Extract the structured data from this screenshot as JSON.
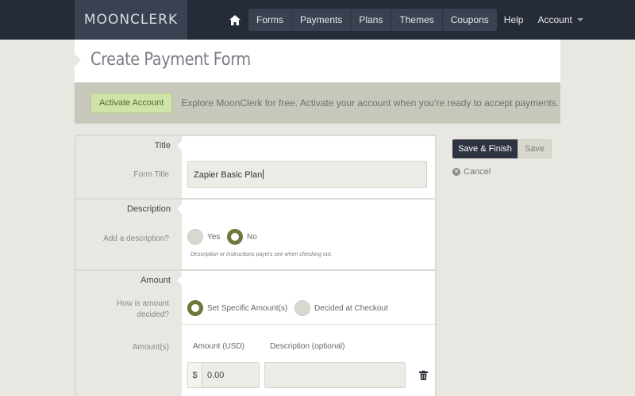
{
  "brand": {
    "logo_text_a": "MOON",
    "logo_text_b": "CLERK"
  },
  "nav": {
    "home_icon": "home-icon",
    "items": [
      {
        "label": "Forms"
      },
      {
        "label": "Payments"
      },
      {
        "label": "Plans"
      },
      {
        "label": "Themes"
      },
      {
        "label": "Coupons"
      }
    ],
    "help": "Help",
    "account": "Account"
  },
  "page": {
    "title": "Create Payment Form"
  },
  "banner": {
    "button": "Activate Account",
    "text": "Explore MoonClerk for free. Activate your account when you're ready to accept payments."
  },
  "sections": {
    "title": {
      "heading": "Title",
      "label": "Form Title",
      "value": "Zapier Basic Plan"
    },
    "description": {
      "heading": "Description",
      "label": "Add a description?",
      "options": [
        {
          "label": "Yes",
          "selected": false
        },
        {
          "label": "No",
          "selected": true
        }
      ],
      "hint": "Description or instructions payers see when checking out."
    },
    "amount": {
      "heading": "Amount",
      "label_line1": "How is amount",
      "label_line2": "decided?",
      "options": [
        {
          "label": "Set Specific Amount(s)",
          "selected": true
        },
        {
          "label": "Decided at Checkout",
          "selected": false
        }
      ],
      "amounts_label": "Amount(s)",
      "col_amount": "Amount (USD)",
      "col_description": "Description (optional)",
      "currency": "$",
      "amount_value": "0.00",
      "description_value": ""
    }
  },
  "actions": {
    "save_finish": "Save & Finish",
    "save": "Save",
    "cancel": "Cancel"
  },
  "colors": {
    "nav_bg": "#262c37",
    "accent_green": "#6b7a3a",
    "activate_bg": "#cfe3a8"
  }
}
